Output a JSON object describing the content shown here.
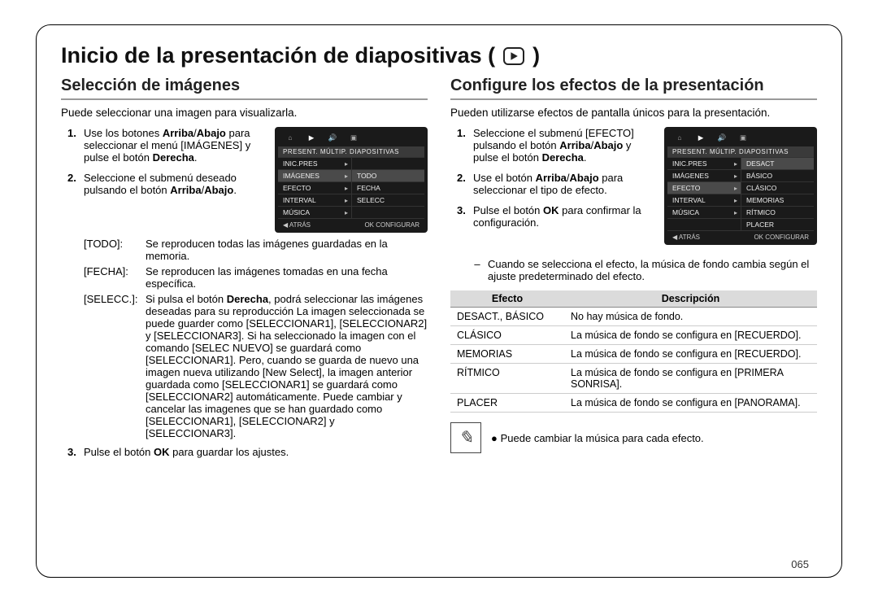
{
  "page_title": "Inicio de la presentación de diapositivas (",
  "page_title_close": ")",
  "page_number": "065",
  "left": {
    "heading": "Selección de imágenes",
    "intro": "Puede seleccionar una imagen para visualizarla.",
    "step1_a": "Use los botones ",
    "step1_b": "Arriba",
    "step1_c": "/",
    "step1_d": "Abajo",
    "step1_e": " para seleccionar el menú [IMÁGENES] y pulse el botón ",
    "step1_f": "Derecha",
    "step1_g": ".",
    "step2_a": "Seleccione el submenú deseado pulsando el botón ",
    "step2_b": "Arriba",
    "step2_c": "/",
    "step2_d": "Abajo",
    "step2_e": ".",
    "defs": {
      "todo_term": "[TODO]:",
      "todo_desc": "Se reproducen todas las imágenes guardadas en la memoria.",
      "fecha_term": "[FECHA]:",
      "fecha_desc": "Se reproducen las imágenes tomadas en una fecha específica.",
      "selecc_term": "[SELECC.]:",
      "selecc_desc_a": "Si pulsa el botón ",
      "selecc_desc_b": "Derecha",
      "selecc_desc_c": ", podrá seleccionar las imágenes deseadas para su reproducción La imagen seleccionada se puede guarder como [SELECCIONAR1], [SELECCIONAR2] y [SELECCIONAR3]. Si ha seleccionado la imagen con el comando [SELEC NUEVO] se guardará como [SELECCIONAR1]. Pero, cuando se guarda de nuevo una imagen nueva utilizando [New Select], la imagen anterior guardada como [SELECCIONAR1] se guardará como [SELECCIONAR2] automáticamente. Puede cambiar y cancelar las imagenes que se han guardado como [SELECCIONAR1], [SELECCIONAR2] y [SELECCIONAR3]."
    },
    "step3_a": "Pulse el botón ",
    "step3_b": "OK",
    "step3_c": " para guardar los ajustes.",
    "lcd": {
      "title": "PRESENT. MÚLTIP. DIAPOSITIVAS",
      "rows": [
        {
          "l": "INIC.PRES",
          "r": ""
        },
        {
          "l": "IMÁGENES",
          "r": "TODO"
        },
        {
          "l": "EFECTO",
          "r": "FECHA"
        },
        {
          "l": "INTERVAL",
          "r": "SELECC"
        },
        {
          "l": "MÚSICA",
          "r": ""
        }
      ],
      "footer_left": "◀  ATRÁS",
      "footer_right": "OK  CONFIGURAR"
    }
  },
  "right": {
    "heading": "Configure los efectos de la presentación",
    "intro": "Pueden utilizarse efectos de pantalla únicos para la presentación.",
    "step1_a": "Seleccione el submenú [EFECTO] pulsando el botón ",
    "step1_b": "Arriba",
    "step1_c": "/",
    "step1_d": "Abajo",
    "step1_e": " y pulse el botón ",
    "step1_f": "Derecha",
    "step1_g": ".",
    "step2_a": "Use el botón ",
    "step2_b": "Arriba",
    "step2_c": "/",
    "step2_d": "Abajo",
    "step2_e": " para seleccionar el tipo de efecto.",
    "step3_a": "Pulse el botón ",
    "step3_b": "OK",
    "step3_c": " para confirmar la configuración.",
    "note": "Cuando se selecciona el efecto, la música de fondo cambia según el ajuste predeterminado del efecto.",
    "table": {
      "h1": "Efecto",
      "h2": "Descripción",
      "rows": [
        {
          "e": "DESACT., BÁSICO",
          "d": "No hay música de fondo."
        },
        {
          "e": "CLÁSICO",
          "d": "La música de fondo se configura en [RECUERDO]."
        },
        {
          "e": "MEMORIAS",
          "d": "La música de fondo se configura en [RECUERDO]."
        },
        {
          "e": "RÍTMICO",
          "d": "La música de fondo se configura en [PRIMERA SONRISA]."
        },
        {
          "e": "PLACER",
          "d": "La música de fondo se configura en [PANORAMA]."
        }
      ]
    },
    "tip": "Puede cambiar la música para cada efecto.",
    "lcd": {
      "title": "PRESENT. MÚLTIP. DIAPOSITIVAS",
      "rows": [
        {
          "l": "INIC.PRES",
          "r": "DESACT"
        },
        {
          "l": "IMÁGENES",
          "r": "BÁSICO"
        },
        {
          "l": "EFECTO",
          "r": "CLÁSICO"
        },
        {
          "l": "INTERVAL",
          "r": "MEMORIAS"
        },
        {
          "l": "MÚSICA",
          "r": "RÍTMICO"
        },
        {
          "l": "",
          "r": "PLACER"
        }
      ],
      "footer_left": "◀  ATRÁS",
      "footer_right": "OK  CONFIGURAR"
    }
  }
}
